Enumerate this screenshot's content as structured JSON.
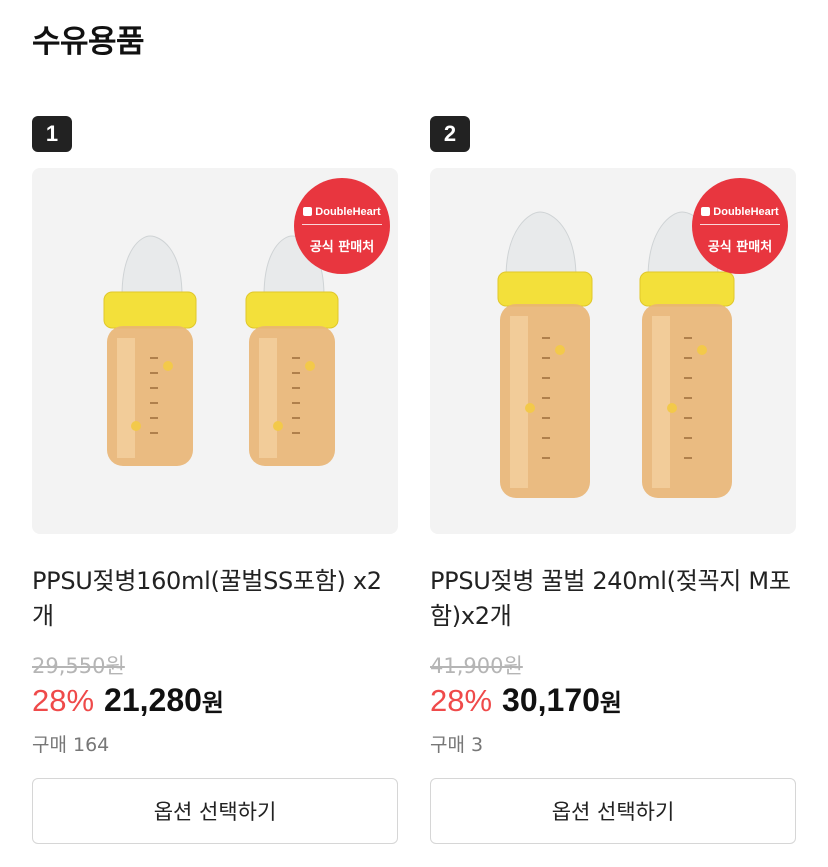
{
  "section": {
    "title": "수유용품"
  },
  "products": [
    {
      "rank": "1",
      "badge_brand": "DoubleHeart",
      "badge_label": "공식 판매처",
      "name": "PPSU젖병160ml(꿀벌SS포함) x2개",
      "original_price": "29,550원",
      "discount": "28%",
      "price": "21,280",
      "currency": "원",
      "sold": "구매 164",
      "option_button": "옵션 선택하기"
    },
    {
      "rank": "2",
      "badge_brand": "DoubleHeart",
      "badge_label": "공식 판매처",
      "name": "PPSU젖병 꿀벌 240ml(젖꼭지 M포함)x2개",
      "original_price": "41,900원",
      "discount": "28%",
      "price": "30,170",
      "currency": "원",
      "sold": "구매 3",
      "option_button": "옵션 선택하기"
    }
  ],
  "colors": {
    "discount": "#ef4a4a",
    "badge": "#e8363f",
    "bottle_cap": "#f3e03a",
    "bottle_body": "#e9b574"
  }
}
